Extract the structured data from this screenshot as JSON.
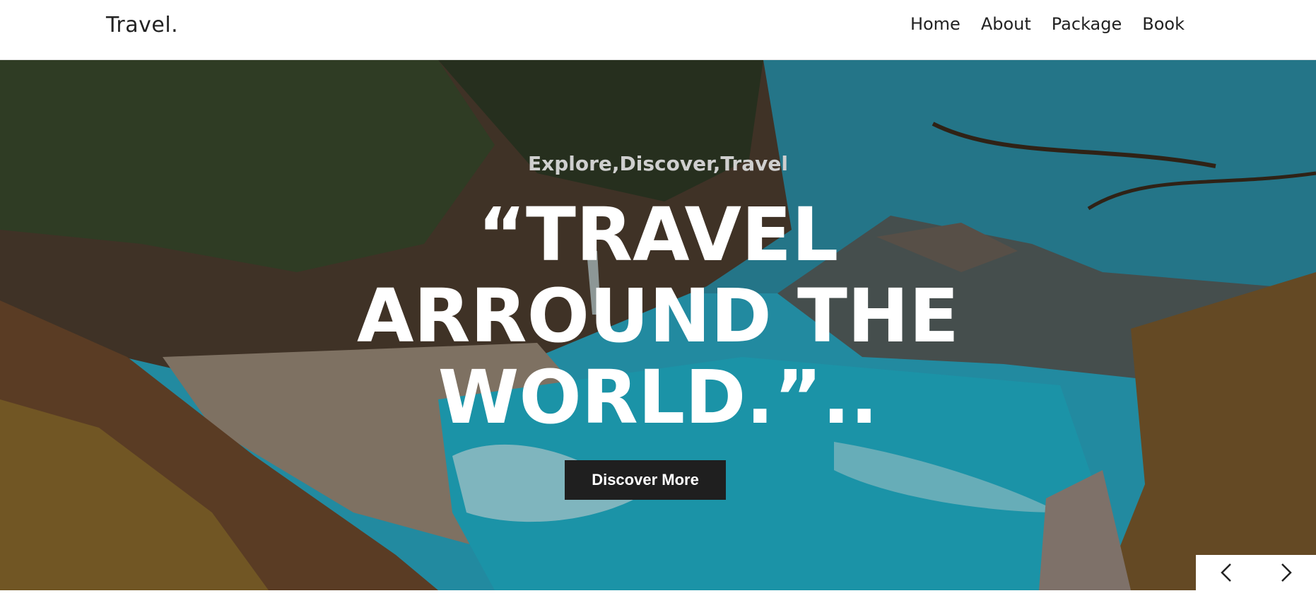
{
  "header": {
    "brand": "Travel.",
    "nav": [
      {
        "label": "Home"
      },
      {
        "label": "About"
      },
      {
        "label": "Package"
      },
      {
        "label": "Book"
      }
    ]
  },
  "hero": {
    "tagline": "Explore,Discover,Travel",
    "headline_lines": [
      "“TRAVEL",
      "ARROUND THE",
      "WORLD.”.."
    ],
    "cta_label": "Discover More",
    "controls": {
      "prev_icon": "chevron-left-icon",
      "next_icon": "chevron-right-icon"
    }
  },
  "colors": {
    "nav_text": "#222222",
    "button_bg": "#1f1f1f",
    "headline_text": "#ffffff",
    "tagline_text": "#cfcfcf"
  }
}
